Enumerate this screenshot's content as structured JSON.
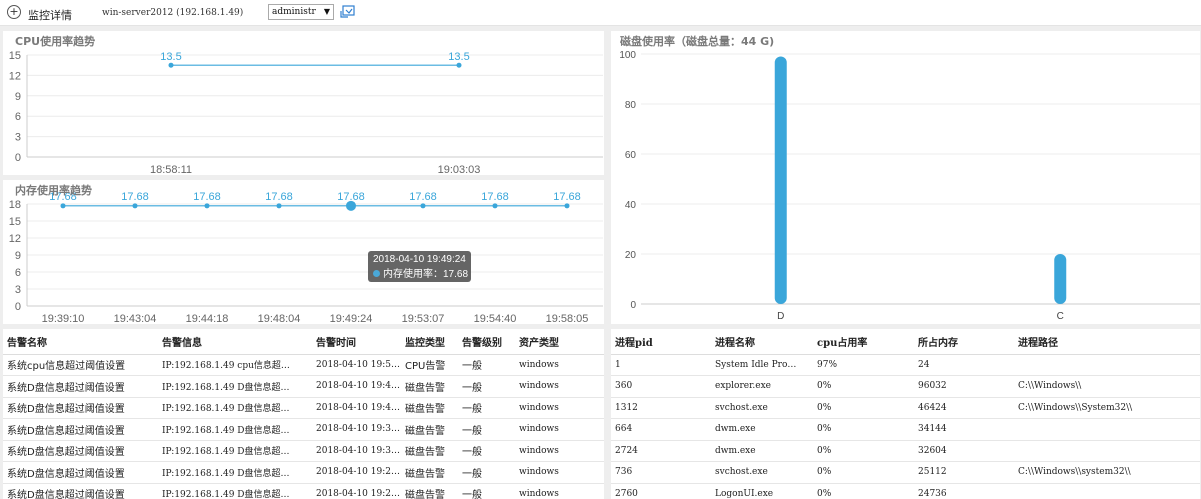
{
  "header": {
    "title": "监控详情",
    "server": "win-server2012 (192.168.1.49)",
    "account_selected": "administr",
    "add_icon": "circle-plus-icon",
    "refresh_icon": "refresh-icon"
  },
  "colors": {
    "accent": "#3aa6da",
    "grid": "#ececec",
    "axis": "#cccccc"
  },
  "cpu_panel": {
    "title": "CPU使用率趋势"
  },
  "mem_panel": {
    "title": "内存使用率趋势",
    "tooltip": {
      "time": "2018-04-10 19:49:24",
      "label": "内存使用率：17.68"
    }
  },
  "disk_panel": {
    "title": "磁盘使用率（磁盘总量：44 G)"
  },
  "chart_data": [
    {
      "type": "line",
      "x": [
        "18:58:11",
        "19:03:03"
      ],
      "series": [
        {
          "values": [
            13.5,
            13.5
          ]
        }
      ],
      "ylim": [
        0,
        15
      ],
      "yticks": [
        0,
        3,
        6,
        9,
        12,
        15
      ],
      "grid": true,
      "data_labels": true
    },
    {
      "type": "line",
      "x": [
        "19:39:10",
        "19:43:04",
        "19:44:18",
        "19:48:04",
        "19:49:24",
        "19:53:07",
        "19:54:40",
        "19:58:05"
      ],
      "series": [
        {
          "values": [
            17.68,
            17.68,
            17.68,
            17.68,
            17.68,
            17.68,
            17.68,
            17.68
          ]
        }
      ],
      "ylim": [
        0,
        18
      ],
      "yticks": [
        0,
        3,
        6,
        9,
        12,
        15,
        18
      ],
      "grid": true,
      "data_labels": true,
      "highlighted_index": 4
    },
    {
      "type": "bar",
      "categories": [
        "D",
        "C"
      ],
      "values": [
        99,
        20
      ],
      "ylim": [
        0,
        100
      ],
      "yticks": [
        0,
        20,
        40,
        60,
        80,
        100
      ],
      "grid": true
    }
  ],
  "alerts": {
    "columns": [
      "告警名称",
      "告警信息",
      "告警时间",
      "监控类型",
      "告警级别",
      "资产类型"
    ],
    "rows": [
      [
        "系统cpu信息超过阈值设置",
        "IP:192.168.1.49 cpu信息超…",
        "2018-04-10 19:5…",
        "CPU告警",
        "一般",
        "windows"
      ],
      [
        "系统D盘信息超过阈值设置",
        "IP:192.168.1.49 D盘信息超…",
        "2018-04-10 19:4…",
        "磁盘告警",
        "一般",
        "windows"
      ],
      [
        "系统D盘信息超过阈值设置",
        "IP:192.168.1.49 D盘信息超…",
        "2018-04-10 19:4…",
        "磁盘告警",
        "一般",
        "windows"
      ],
      [
        "系统D盘信息超过阈值设置",
        "IP:192.168.1.49 D盘信息超…",
        "2018-04-10 19:3…",
        "磁盘告警",
        "一般",
        "windows"
      ],
      [
        "系统D盘信息超过阈值设置",
        "IP:192.168.1.49 D盘信息超…",
        "2018-04-10 19:3…",
        "磁盘告警",
        "一般",
        "windows"
      ],
      [
        "系统D盘信息超过阈值设置",
        "IP:192.168.1.49 D盘信息超…",
        "2018-04-10 19:2…",
        "磁盘告警",
        "一般",
        "windows"
      ],
      [
        "系统D盘信息超过阈值设置",
        "IP:192.168.1.49 D盘信息超…",
        "2018-04-10 19:2…",
        "磁盘告警",
        "一般",
        "windows"
      ]
    ]
  },
  "processes": {
    "columns": [
      "进程pid",
      "进程名称",
      "cpu占用率",
      "所占内存",
      "进程路径"
    ],
    "rows": [
      [
        "1",
        "System Idle Pro…",
        "97%",
        "24",
        ""
      ],
      [
        "360",
        "explorer.exe",
        "0%",
        "96032",
        "C:\\\\Windows\\\\"
      ],
      [
        "1312",
        "svchost.exe",
        "0%",
        "46424",
        "C:\\\\Windows\\\\System32\\\\"
      ],
      [
        "664",
        "dwm.exe",
        "0%",
        "34144",
        ""
      ],
      [
        "2724",
        "dwm.exe",
        "0%",
        "32604",
        ""
      ],
      [
        "736",
        "svchost.exe",
        "0%",
        "25112",
        "C:\\\\Windows\\\\system32\\\\"
      ],
      [
        "2760",
        "LogonUI.exe",
        "0%",
        "24736",
        ""
      ]
    ]
  }
}
